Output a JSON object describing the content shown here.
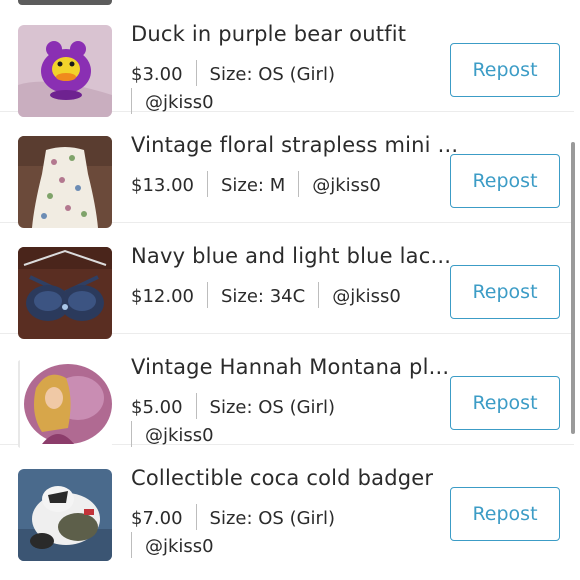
{
  "listings": [
    {
      "title": "Duck in purple bear outfit",
      "price": "$3.00",
      "size": "Size: OS (Girl)",
      "user": "@jkiss0",
      "action": "Repost"
    },
    {
      "title": "Vintage floral strapless mini ...",
      "price": "$13.00",
      "size": "Size: M",
      "user": "@jkiss0",
      "action": "Repost"
    },
    {
      "title": "Navy blue and light blue lac...",
      "price": "$12.00",
      "size": "Size: 34C",
      "user": "@jkiss0",
      "action": "Repost"
    },
    {
      "title": "Vintage Hannah Montana pl...",
      "price": "$5.00",
      "size": "Size: OS (Girl)",
      "user": "@jkiss0",
      "action": "Repost"
    },
    {
      "title": "Collectible coca cold badger",
      "price": "$7.00",
      "size": "Size: OS (Girl)",
      "user": "@jkiss0",
      "action": "Repost"
    }
  ],
  "theme": {
    "accent": "#3c9cc6",
    "text": "#2b2b2b",
    "separator": "#bdbdbd"
  }
}
